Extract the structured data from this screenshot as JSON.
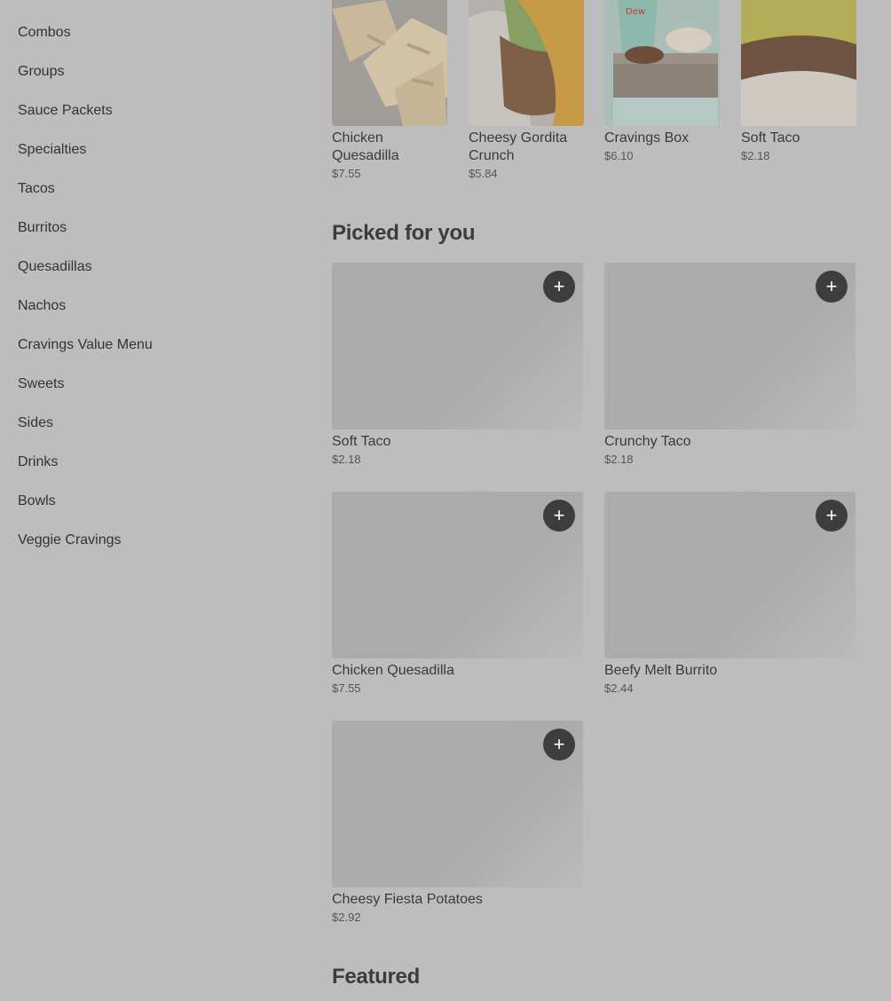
{
  "sidebar": {
    "items": [
      {
        "label": "Combos"
      },
      {
        "label": "Groups"
      },
      {
        "label": "Sauce Packets"
      },
      {
        "label": "Specialties"
      },
      {
        "label": "Tacos"
      },
      {
        "label": "Burritos"
      },
      {
        "label": "Quesadillas"
      },
      {
        "label": "Nachos"
      },
      {
        "label": "Cravings Value Menu"
      },
      {
        "label": "Sweets"
      },
      {
        "label": "Sides"
      },
      {
        "label": "Drinks"
      },
      {
        "label": "Bowls"
      },
      {
        "label": "Veggie Cravings"
      }
    ]
  },
  "carousel": {
    "items": [
      {
        "name": "Chicken Quesadilla",
        "price": "$7.55"
      },
      {
        "name": "Cheesy Gordita Crunch",
        "price": "$5.84"
      },
      {
        "name": "Cravings Box",
        "price": "$6.10"
      },
      {
        "name": "Soft Taco",
        "price": "$2.18"
      }
    ]
  },
  "picked": {
    "title": "Picked for you",
    "add_label": "+",
    "items": [
      {
        "name": "Soft Taco",
        "price": "$2.18"
      },
      {
        "name": "Crunchy Taco",
        "price": "$2.18"
      },
      {
        "name": "Chicken Quesadilla",
        "price": "$7.55"
      },
      {
        "name": "Beefy Melt Burrito",
        "price": "$2.44"
      },
      {
        "name": "Cheesy Fiesta Potatoes",
        "price": "$2.92"
      }
    ]
  },
  "featured": {
    "title": "Featured"
  },
  "colors": {
    "overlay": "#bdbdbd",
    "button": "#3d3d3d"
  }
}
